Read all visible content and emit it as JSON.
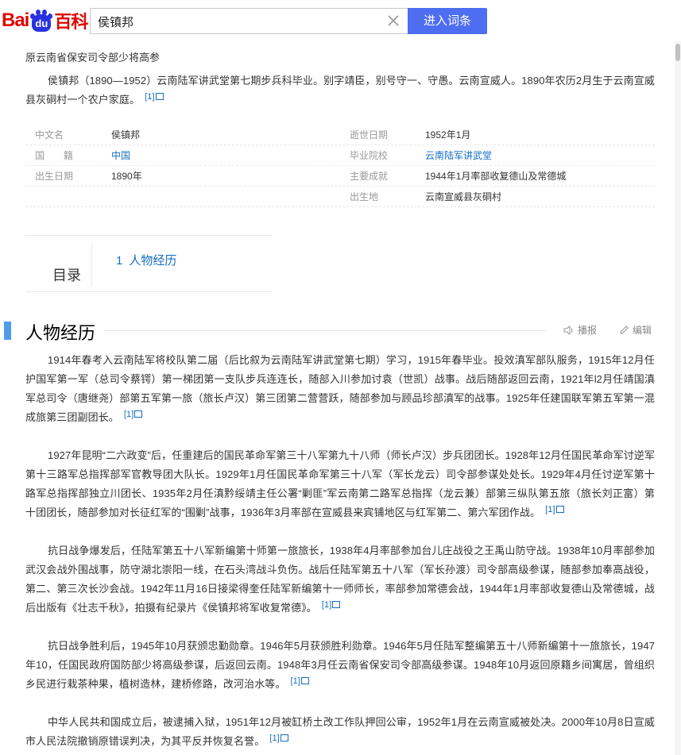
{
  "header": {
    "logo_text_left": "Bai",
    "logo_paw_text": "du",
    "logo_text_right": "百科",
    "search_value": "侯镇邦",
    "enter_button": "进入词条"
  },
  "subtitle": "原云南省保安司令部少将高参",
  "summary": {
    "text": "侯镇邦（1890—1952）云南陆军讲武堂第七期步兵科毕业。别字靖臣，别号守一、守愚。云南宣威人。1890年农历2月生于云南宣威县灰硐村一个农户家庭。",
    "cite": "[1]"
  },
  "basic_info": {
    "rows": [
      {
        "k1": "中文名",
        "v1": "侯镇邦",
        "k2": "逝世日期",
        "v2": "1952年1月"
      },
      {
        "k1": "国　　籍",
        "v1": "中国",
        "k2": "毕业院校",
        "v2": "云南陆军讲武堂"
      },
      {
        "k1": "出生日期",
        "v1": "1890年",
        "k2": "主要成就",
        "v2": "1944年1月率部收复德山及常德城"
      },
      {
        "k1": "",
        "v1": "",
        "k2": "出生地",
        "v2": "云南宣威县灰硐村"
      }
    ]
  },
  "catalog": {
    "title": "目录",
    "items": [
      {
        "num": "1",
        "label": "人物经历"
      }
    ]
  },
  "section": {
    "title": "人物经历",
    "play_label": "播报",
    "edit_label": "编辑"
  },
  "paragraphs": [
    {
      "text": "1914年春考入云南陆军将校队第二届（后比叙为云南陆军讲武堂第七期）学习，1915年春毕业。投效滇军部队服务，1915年12月任护国军第一军（总司令蔡锷）第一梯团第一支队步兵连连长，随部入川参加讨袁（世凯）战事。战后随部返回云南，1921年l2月任靖国滇军总司令（唐继尧）部第五军第一旅（旅长卢汉）第三团第二营营跃，随部参加与顾品珍部滇军的战事。1925年任建国联军第五军第一混成旅第三团副团长。",
      "cite": "[1]"
    },
    {
      "text": "1927年昆明“二六政变”后，任重建后的国民革命军第三十八军第九十八师（师长卢汉）步兵团团长。1928年12月任国民革命军讨逆军第十三路军总指挥部军官教导团大队长。1929年1月任国民革命军第三十八军（军长龙云）司令部参谋处处长。1929年4月任讨逆军第十路军总指挥部独立川团长、1935年2月任滇黔绥靖主任公署“剿匪”军云南第二路军总指挥（龙云兼）部第三纵队第五旅（旅长刘正富）第十团团长，随部参加对长征红军的“围剿”战事，1936年3月率部在宣威县来宾铺地区与红军第二、第六军团作战。",
      "cite": "[1]"
    },
    {
      "text": "抗日战争爆发后，任陆军第五十八军新编第十师第一旅旅长，1938年4月率部参加台儿庄战役之王禹山防守战。1938年10月率部参加武汉会战外围战事，防守湖北崇阳一线，在石头湾战斗负伤。战后任陆军第五十八军（军长孙渡）司令部高级参谋，随部参加奉高战役，第二、第三次长沙会战。1942年11月16日接梁得奎任陆军新编第十一师师长，率部参加常德会战，1944年1月率部收复德山及常德城，战后出版有《壮志千秋》，拍摄有纪录片《侯镇邦将军收复常德》。",
      "cite": "[1]"
    },
    {
      "text": "抗日战争胜利后，1945年10月获颁忠勤勋章。1946年5月获颁胜利勋章。1946年5月任陆军整编第五十八师新编第十一旅旅长，1947年10，任国民政府国防部少将高级参谋，后返回云南。1948年3月任云南省保安司令部高级参谋。1948年10月返回原籍乡间寓居，曾组织乡民进行栽茶种果，植树造林，建桥修路，改河治水等。",
      "cite": "[1]"
    },
    {
      "text": "中华人民共和国成立后，被逮捕入狱，1951年12月被缸桥土改工作队押回公审，1952年1月在云南宣威被处决。2000年10月8日宣威市人民法院撤销原错误判决，为其平反并恢复名誉。",
      "cite": "[1]"
    }
  ],
  "colors": {
    "accent": "#4e6ef2",
    "link": "#136ec2",
    "logo_red": "#e10601",
    "logo_blue": "#2932e1",
    "section_bar": "#4f9cee"
  }
}
